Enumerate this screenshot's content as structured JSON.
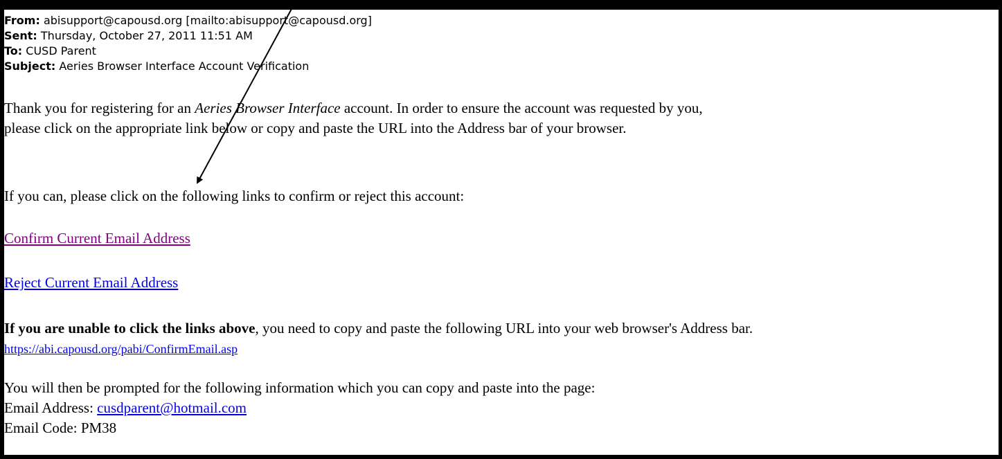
{
  "header": {
    "from_label": "From:",
    "from_value": "abisupport@capousd.org [mailto:abisupport@capousd.org]",
    "sent_label": "Sent:",
    "sent_value": "Thursday, October 27, 2011 11:51 AM",
    "to_label": "To:",
    "to_value": "CUSD Parent",
    "subject_label": "Subject:",
    "subject_value": "Aeries Browser Interface Account Verification"
  },
  "body": {
    "para1_pre": "Thank you for registering for an ",
    "para1_italic": "Aeries Browser Interface",
    "para1_post": " account. In order to ensure the account was requested by you,",
    "para1_line2": "please click on the appropriate link below or copy and paste the URL into the Address bar of your browser.",
    "para2": "If you can, please click on the following links to confirm or reject this account:",
    "confirm_link": "Confirm Current Email Address",
    "reject_link": "Reject Current Email Address",
    "para3_bold": "If you are unable to click the links above",
    "para3_rest": ", you need to copy and paste the following URL into your web browser's Address bar.",
    "url_link": "https://abi.capousd.org/pabi/ConfirmEmail.asp",
    "para4": "You will then be prompted for the following information which you can copy and paste into the page:",
    "email_label": "Email Address: ",
    "email_value": "cusdparent@hotmail.com",
    "code_label": "Email Code: ",
    "code_value": "PM38"
  },
  "colors": {
    "visited_link": "#800080",
    "unvisited_link": "#0000ee"
  }
}
